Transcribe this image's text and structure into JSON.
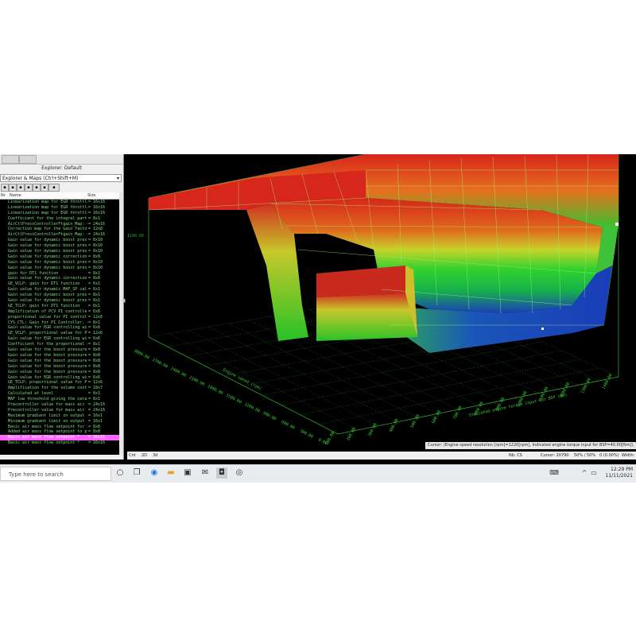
{
  "left_panel": {
    "title": "Explorer: Default",
    "dropdown": "Explorer & Maps (Ctrl+Shift+M)",
    "columns": {
      "no": "Nr",
      "name": "Name",
      "size": "Size"
    },
    "rows": [
      {
        "name": "Linearization map for EGR throttle",
        "size": "16x16"
      },
      {
        "name": "Linearization map for EGR throttle",
        "size": "16x16"
      },
      {
        "name": "Linearization map for EGR throttle",
        "size": "16x16"
      },
      {
        "name": "Coefficient for the integral part of the P",
        "size": "8x1"
      },
      {
        "name": "AirCtlPressControllerFtgain_Map: Controller",
        "size": "24x16"
      },
      {
        "name": "Correction map for the Gain factor for th",
        "size": "12x8"
      },
      {
        "name": "AirCtlPressControllerFtgain_Map: Controlle",
        "size": "24x16"
      },
      {
        "name": "Gain value for dynamic boost pressure a",
        "size": "8x10"
      },
      {
        "name": "Gain value for dynamic boost pressure a",
        "size": "8x10"
      },
      {
        "name": "Gain value for dynamic boost pressure a",
        "size": "8x10"
      },
      {
        "name": "Gain value for dynamic correction of boo",
        "size": "8x8"
      },
      {
        "name": "Gain value for dynamic boost pressure a",
        "size": "8x10"
      },
      {
        "name": "Gain value for dynamic boost pressure a",
        "size": "8x10"
      },
      {
        "name": "gain for DT1 function",
        "size": "8x1"
      },
      {
        "name": "Gain value for dynamic correction of boo",
        "size": "8x8"
      },
      {
        "name": "GE_VCLP: gain for DT1 function",
        "size": "6x1"
      },
      {
        "name": "Gain value for dynamic MAF_SP calculati",
        "size": "6x1"
      },
      {
        "name": "Gain value for dynamic boost pressure a",
        "size": "8x1"
      },
      {
        "name": "Gain value for dynamic boost pressure a",
        "size": "8x1"
      },
      {
        "name": "GE_TCLP: gain for DT1 function",
        "size": "8x1"
      },
      {
        "name": "Amplification of PCV PI controller",
        "size": "6x6"
      },
      {
        "name": "proportional value for PI controller",
        "size": "12x6"
      },
      {
        "name": "CYS_CTL: Gain for PI Controller, depen",
        "size": "8x1"
      },
      {
        "name": "Gain value for EGR controlling with the",
        "size": "6x6"
      },
      {
        "name": "GE_VCLP: proportional value for PI cont",
        "size": "12x6"
      },
      {
        "name": "Gain value for EGR controlling with the",
        "size": "6x6"
      },
      {
        "name": "Coefficient for the proportional part of t",
        "size": "8x1"
      },
      {
        "name": "Gain value for the boost pressure PI cor",
        "size": "8x8"
      },
      {
        "name": "Gain value for the boost pressure PI cor",
        "size": "8x8"
      },
      {
        "name": "Gain value for the boost pressure PI cor",
        "size": "8x8"
      },
      {
        "name": "Gain value for the boost pressure PI cor",
        "size": "8x8"
      },
      {
        "name": "Gain value for the boost pressure PI cor",
        "size": "8x8"
      },
      {
        "name": "Gain value for EGR controlling with the",
        "size": "6x6"
      },
      {
        "name": "GE_TCLP: proportional value for PI cont",
        "size": "12x6"
      },
      {
        "name": "Amplification for the volume control val",
        "size": "10x7"
      },
      {
        "name": "Calculated at level",
        "size": "8x1"
      },
      {
        "name": "MAF low threshold giving the catalyst pr",
        "size": "8x1"
      },
      {
        "name": "Precontroller value for mass air flow in",
        "size": "24x16"
      },
      {
        "name": "Precontroller value for mass air flow in",
        "size": "24x16"
      },
      {
        "name": "Maximum gradient limit on output signal",
        "size": "16x1"
      },
      {
        "name": "Minimum gradient limit on output signal",
        "size": "16x1"
      },
      {
        "name": "Basic air mass flow setpoint for EGR",
        "size": "8x8"
      },
      {
        "name": "Added air mass flow setpoint to protect",
        "size": "8x8"
      },
      {
        "name": "Basic air mass flow setpoint *",
        "size": "16x16",
        "selected": true
      },
      {
        "name": "Basic air mass flow setpoint *",
        "size": "16x16"
      }
    ]
  },
  "plot": {
    "y_axis_labels": [
      "3000.00",
      "2700.00",
      "2400.00",
      "2100.00",
      "1800.00",
      "1500.00",
      "1200.00",
      "900.00",
      "600.00",
      "300.00",
      "0.00"
    ],
    "x_axis_labels": [
      "100.00",
      "200.00",
      "300.00",
      "400.00",
      "500.00",
      "600.00",
      "700.00",
      "800.00",
      "900.00",
      "1000.00",
      "1100.00",
      "1200.00",
      "1300.00",
      "1400.00"
    ],
    "x_axis_title": "Indicated engine torque input for BSP (Nm)",
    "y_axis_title": "Engine speed (rpm)",
    "z_label": "1100.00",
    "status_text": "Cursor: (Engine speed  resolution [rpm]=1220[rpm], Indicated engine torque input for BSP=40.00[Nm]), Value:403"
  },
  "bottom_bar": {
    "tabs": [
      "Cnt",
      "2D",
      "3d"
    ],
    "nb": "Nb: CS",
    "cursor": "Cursor: 20790",
    "ratio": "50% / 50%",
    "diff": "0 (0.00%)",
    "width": "Width: 1"
  },
  "taskbar": {
    "search_placeholder": "Type here to search",
    "time": "12:29 PM",
    "date": "11/11/2021",
    "lang": "ENG"
  },
  "colors": {
    "high": "#d7261b",
    "mid": "#27c227",
    "low": "#1a3db8",
    "grid": "#39d139"
  }
}
